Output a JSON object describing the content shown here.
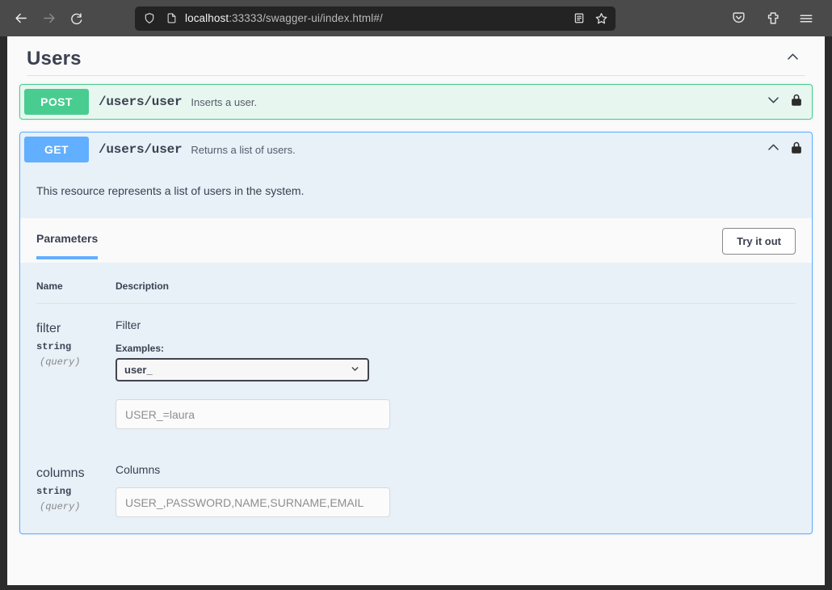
{
  "browser": {
    "back_icon": "back-arrow-icon",
    "forward_icon": "forward-arrow-icon",
    "reload_icon": "reload-icon",
    "shield_icon": "shield-icon",
    "page_icon": "page-icon",
    "url": "localhost:33333/swagger-ui/index.html#/",
    "url_host": "localhost",
    "url_rest": ":33333/swagger-ui/index.html#/",
    "reader_icon": "reader-mode-icon",
    "bookmark_icon": "bookmark-star-icon",
    "save_to_pocket_icon": "save-to-pocket-icon",
    "extensions_icon": "extensions-icon",
    "menu_icon": "hamburger-menu-icon"
  },
  "tag": {
    "title": "Users",
    "collapse_icon": "chevron-up-icon"
  },
  "operations": [
    {
      "method": "POST",
      "path": "/users/user",
      "summary": "Inserts a user.",
      "expanded": false,
      "toggle_icon": "chevron-down-icon",
      "auth_icon": "lock-icon"
    },
    {
      "method": "GET",
      "path": "/users/user",
      "summary": "Returns a list of users.",
      "expanded": true,
      "toggle_icon": "chevron-up-icon",
      "auth_icon": "lock-icon",
      "description": "This resource represents a list of users in the system.",
      "tabs": [
        {
          "label": "Parameters",
          "active": true
        }
      ],
      "try_it_out_label": "Try it out",
      "parameters_table": {
        "headers": {
          "name": "Name",
          "description": "Description"
        },
        "rows": [
          {
            "name": "filter",
            "type": "string",
            "in": "(query)",
            "description": "Filter",
            "examples_label": "Examples:",
            "example_selected": "user_",
            "select_caret_icon": "chevron-down-icon",
            "input_placeholder": "USER_=laura",
            "input_value": ""
          },
          {
            "name": "columns",
            "type": "string",
            "in": "(query)",
            "description": "Columns",
            "input_placeholder": "USER_,PASSWORD,NAME,SURNAME,EMAIL",
            "input_value": ""
          }
        ]
      }
    }
  ],
  "colors": {
    "post": "#49cc90",
    "get": "#61affe",
    "text": "#3b4151",
    "tab_active_underline": "#61affe",
    "get_body_bg": "#e8f0f8",
    "post_bg": "#e8f6f0"
  }
}
